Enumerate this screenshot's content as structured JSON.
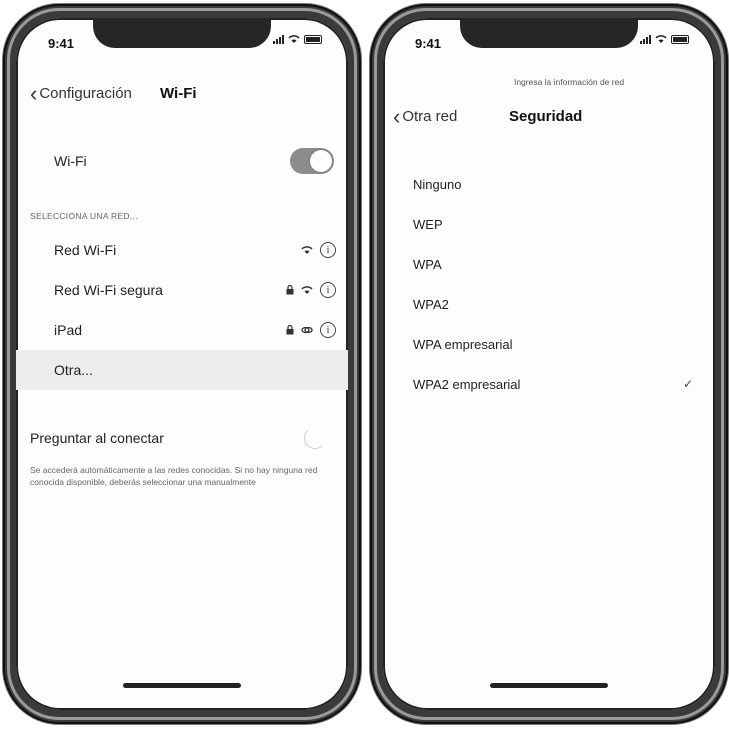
{
  "left": {
    "status": {
      "time": "9:41"
    },
    "nav": {
      "back_label": "Configuración",
      "title": "Wi-Fi"
    },
    "wifi_row": {
      "label": "Wi-Fi",
      "enabled": true
    },
    "section_header": "SELECCIONA UNA RED...",
    "networks": [
      {
        "name": "Red Wi-Fi",
        "locked": false,
        "icon": "wifi-icon"
      },
      {
        "name": "Red Wi-Fi segura",
        "locked": true,
        "icon": "wifi-icon"
      },
      {
        "name": "iPad",
        "locked": true,
        "icon": "hotspot-link-icon"
      }
    ],
    "other_label": "Otra...",
    "ask_label": "Preguntar al conectar",
    "ask_enabled": false,
    "description": "Se accederá automáticamente a las redes conocidas. Si no hay ninguna red conocida disponible, deberás seleccionar una manualmente"
  },
  "right": {
    "status": {
      "time": "9:41"
    },
    "header_text": "Ingresa la información de red",
    "nav": {
      "back_label": "Otra red",
      "title": "Seguridad"
    },
    "options": [
      "Ninguno",
      "WEP",
      "WPA",
      "WPA2",
      "WPA empresarial",
      "WPA2 empresarial"
    ],
    "selected": "WPA2 empresarial",
    "check_glyph": "✓"
  },
  "colors": {
    "toggle_on": "#8c8c8c",
    "otra_row_bg": "#ededf0",
    "frame": "#3a3a3a"
  }
}
